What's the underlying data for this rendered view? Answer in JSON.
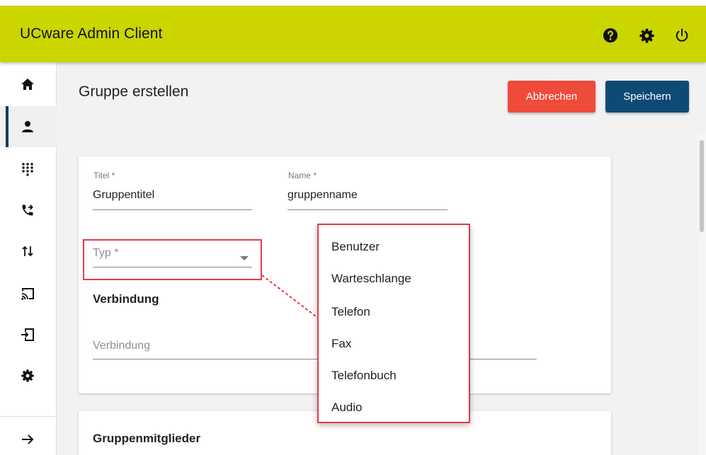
{
  "header": {
    "title": "UCware Admin Client",
    "icons": [
      "help-icon",
      "gear-icon",
      "power-icon"
    ]
  },
  "sidebar": {
    "items": [
      {
        "name": "home",
        "icon": "home-icon"
      },
      {
        "name": "users",
        "icon": "user-icon",
        "active": true
      },
      {
        "name": "dialpad",
        "icon": "dialpad-icon"
      },
      {
        "name": "call-forwarding",
        "icon": "phone-forward-icon"
      },
      {
        "name": "transfer",
        "icon": "swap-vertical-icon"
      },
      {
        "name": "cast",
        "icon": "cast-icon"
      },
      {
        "name": "login",
        "icon": "login-icon"
      },
      {
        "name": "settings",
        "icon": "gear-icon"
      },
      {
        "name": "expand",
        "icon": "arrow-right-icon"
      }
    ]
  },
  "page": {
    "title": "Gruppe erstellen",
    "cancel_label": "Abbrechen",
    "save_label": "Speichern"
  },
  "form": {
    "title_label": "Titel *",
    "title_value": "Gruppentitel",
    "name_label": "Name *",
    "name_value": "gruppenname",
    "type_placeholder": "Typ *",
    "connection_heading": "Verbindung",
    "connection_placeholder": "Verbindung",
    "members_heading": "Gruppenmitglieder"
  },
  "dropdown": {
    "options": [
      "Benutzer",
      "Warteschlange",
      "Telefon",
      "Fax",
      "Telefonbuch",
      "Audio"
    ]
  },
  "colors": {
    "header": "#cbd500",
    "cancel": "#ef4b3b",
    "save": "#0f4a75",
    "active_nav": "#123d5f",
    "highlight": "#e53c48"
  }
}
